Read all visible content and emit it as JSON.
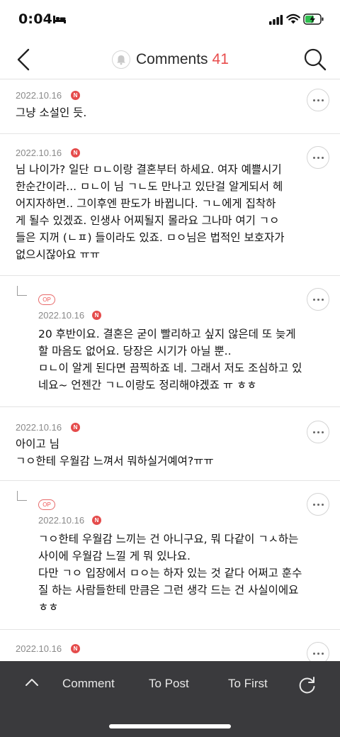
{
  "status_bar": {
    "time": "0:04",
    "icons": [
      "bed-icon",
      "cellular-signal-icon",
      "wifi-icon",
      "battery-charging-icon"
    ],
    "battery_color": "#2fbf4f"
  },
  "nav": {
    "title": "Comments",
    "count": "41",
    "count_color": "#e84c4c",
    "icons": [
      "back-chevron-icon",
      "bell-icon",
      "search-icon"
    ]
  },
  "comments": [
    {
      "date": "2022.10.16",
      "badge": "N",
      "text": "그냥 소설인 듯."
    },
    {
      "date": "2022.10.16",
      "badge": "N",
      "text": "님 나이가? 일단 ㅁㄴ이랑 결혼부터 하세요. 여자 예쁠시기\n한순간이라... ㅁㄴ이 님 ㄱㄴ도 만나고 있단걸 알게되서 헤\n어지자하면.. 그이후엔 판도가 바뀝니다. ㄱㄴ에게 집착하\n게 될수 있겠죠. 인생사 어찌될지 몰라요 그나마 여기 ㄱㅇ\n들은 지꺼 (ㄴㅍ) 들이라도 있죠. ㅁㅇ님은 법적인 보호자가\n없으시잖아요 ㅠㅠ"
    },
    {
      "reply": true,
      "op": "OP",
      "date": "2022.10.16",
      "badge": "N",
      "text": "20 후반이요. 결혼은 굳이 빨리하고 싶지 않은데 또 늦게\n할 마음도 없어요. 당장은 시기가 아닐 뿐..\nㅁㄴ이 알게 된다면 끔찍하죠 네. 그래서 저도 조심하고 있\n네요~ 언젠간 ㄱㄴ이랑도 정리해야겠죠 ㅠ ㅎㅎ"
    },
    {
      "date": "2022.10.16",
      "badge": "N",
      "text": "아이고 님\nㄱㅇ한테 우월감 느껴서 뭐하실거예여?ㅠㅠ"
    },
    {
      "reply": true,
      "op": "OP",
      "date": "2022.10.16",
      "badge": "N",
      "text": "ㄱㅇ한테 우월감 느끼는 건 아니구요, 뭐 다같이 ㄱㅅ하는\n사이에 우월감 느낄 게 뭐 있나요.\n다만 ㄱㅇ 입장에서 ㅁㅇ는 하자 있는 것 같다 어쩌고 훈수\n질 하는 사람들한테 만큼은 그런 생각 드는 건 사실이에요\nㅎㅎ"
    },
    {
      "date": "2022.10.16",
      "badge": "N",
      "text": ""
    }
  ],
  "bottom_bar": {
    "up_icon": "chevron-up-icon",
    "comment_label": "Comment",
    "to_post_label": "To Post",
    "to_first_label": "To First",
    "refresh_icon": "refresh-icon"
  }
}
